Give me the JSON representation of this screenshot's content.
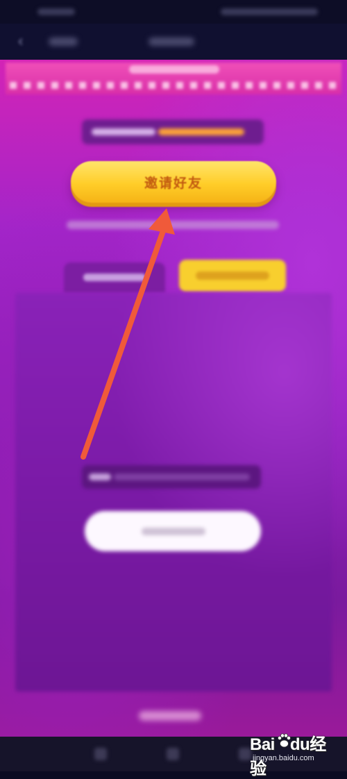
{
  "invite": {
    "label": "邀请好友"
  },
  "watermark": {
    "brand_left": "Bai",
    "brand_mid": "du",
    "brand_right": "经验",
    "site": "jingyan.baidu.com"
  },
  "colors": {
    "invite_button": "#ffcd28",
    "invite_text": "#c25a10",
    "annotation_arrow": "#f05a3a",
    "background_purple": "#8a1fb6"
  },
  "icons": {
    "back": "back-arrow-icon",
    "annotation": "red-pointer-arrow-icon",
    "watermark_paw": "baidu-paw-icon"
  }
}
